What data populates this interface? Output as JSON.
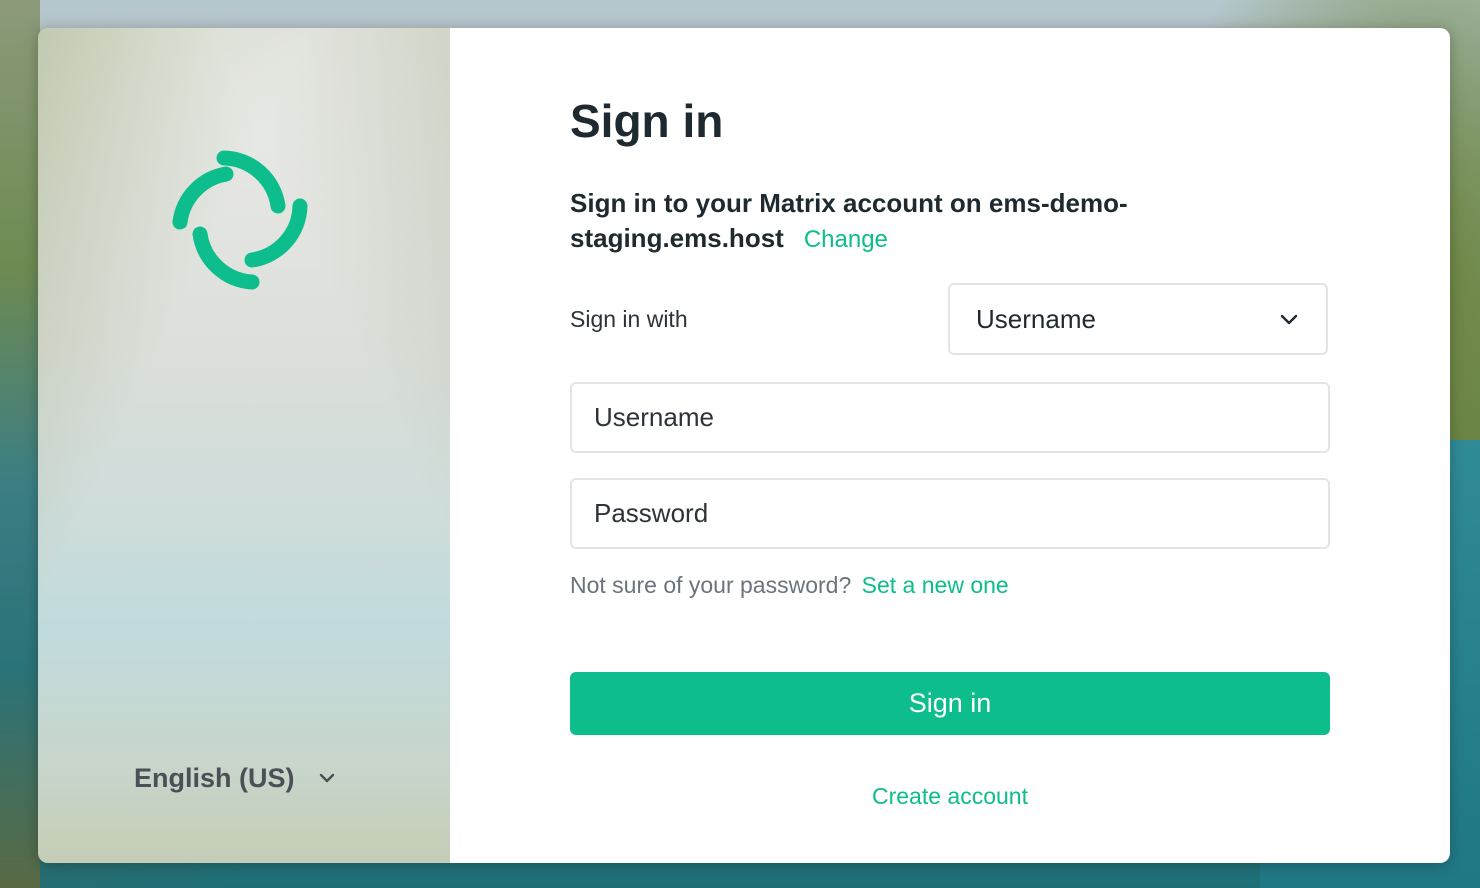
{
  "auth": {
    "title": "Sign in",
    "subtitle": "Sign in to your Matrix account on ems-demo-staging.ems.host",
    "change_link": "Change",
    "sign_in_with_label": "Sign in with",
    "sign_in_with_value": "Username",
    "username_placeholder": "Username",
    "password_placeholder": "Password",
    "forgot_prefix": "Not sure of your password?",
    "forgot_link": "Set a new one",
    "submit_label": "Sign in",
    "create_account": "Create account"
  },
  "sidebar": {
    "language": "English (US)"
  },
  "icons": {
    "logo": "element-logo-icon",
    "language_chevron": "chevron-down-icon",
    "select_chevron": "chevron-down-icon"
  },
  "colors": {
    "accent": "#0dbd8b",
    "text_primary": "#1f2a30",
    "text_secondary": "#6b737d",
    "border": "#e2e5e8"
  }
}
